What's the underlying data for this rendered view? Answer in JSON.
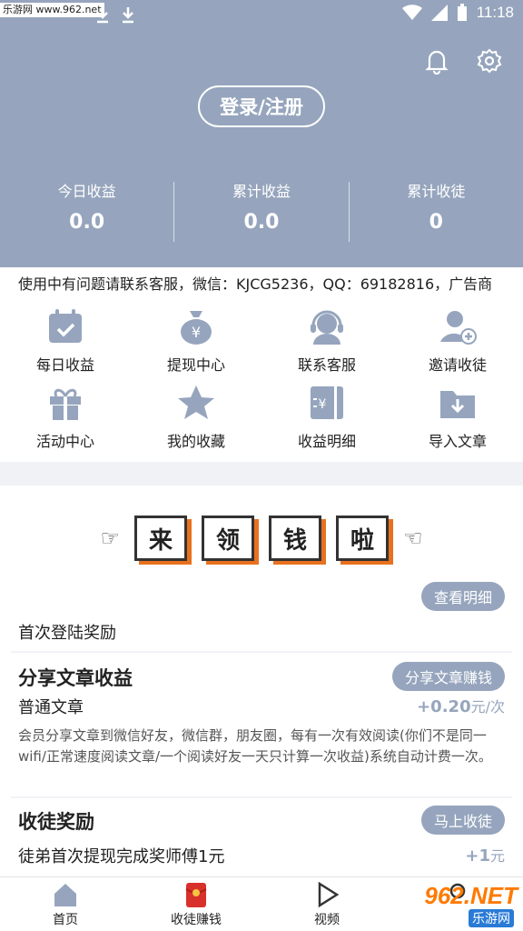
{
  "status_bar": {
    "watermark": "乐游网 www.962.net",
    "time": "11:18"
  },
  "header": {
    "login_label": "登录/注册",
    "stats": [
      {
        "label": "今日收益",
        "value": "0.0"
      },
      {
        "label": "累计收益",
        "value": "0.0"
      },
      {
        "label": "累计收徒",
        "value": "0"
      }
    ],
    "icons": [
      "bell-icon",
      "gear-icon"
    ]
  },
  "notice": {
    "text": "使用中有问题请联系客服，微信：KJCG5236，QQ：69182816，广告商"
  },
  "grid": [
    {
      "label": "每日收益",
      "icon": "calendar-check-icon"
    },
    {
      "label": "提现中心",
      "icon": "money-bag-icon"
    },
    {
      "label": "联系客服",
      "icon": "headset-icon"
    },
    {
      "label": "邀请收徒",
      "icon": "add-user-icon"
    },
    {
      "label": "活动中心",
      "icon": "gift-icon"
    },
    {
      "label": "我的收藏",
      "icon": "star-icon"
    },
    {
      "label": "收益明细",
      "icon": "bill-icon"
    },
    {
      "label": "导入文章",
      "icon": "import-folder-icon"
    }
  ],
  "banner": {
    "chars": [
      "来",
      "领",
      "钱",
      "啦"
    ]
  },
  "rewards": {
    "detail_button": "查看明细",
    "first_login": "首次登陆奖励",
    "share": {
      "title": "分享文章收益",
      "button": "分享文章赚钱",
      "item": "普通文章",
      "amount": "+0.20",
      "unit": "元/次",
      "description": "会员分享文章到微信好友，微信群，朋友圈，每有一次有效阅读(你们不是同一wifi/正常速度阅读文章/一个阅读好友一天只计算一次收益)系统自动计费一次。"
    },
    "apprentice": {
      "title": "收徒奖励",
      "button": "马上收徒",
      "item": "徒弟首次提现完成奖师傅1元",
      "amount": "+1",
      "unit": "元"
    }
  },
  "tabbar": [
    {
      "label": "首页",
      "icon": "home-icon"
    },
    {
      "label": "收徒赚钱",
      "icon": "red-envelope-icon"
    },
    {
      "label": "视频",
      "icon": "play-icon"
    },
    {
      "label": "",
      "icon": "user-icon"
    }
  ],
  "watermark_brand": {
    "logo": "962.NET",
    "sub": "乐游网"
  },
  "colors": {
    "primary": "#96a5bd",
    "accent": "#e8711f",
    "background": "#f1f2f5"
  }
}
